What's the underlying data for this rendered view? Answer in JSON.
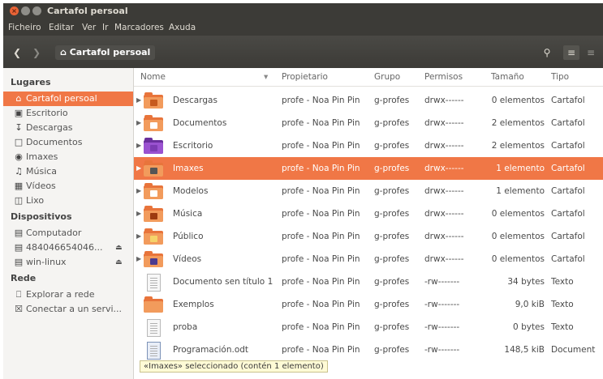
{
  "window": {
    "title": "Cartafol persoal"
  },
  "menubar": [
    "Ficheiro",
    "Editar",
    "Ver",
    "Ir",
    "Marcadores",
    "Axuda"
  ],
  "toolbar": {
    "back_icon": "back-arrow-icon",
    "forward_icon": "forward-arrow-icon",
    "location": "Cartafol persoal",
    "search_icon": "search-icon",
    "list_view_icon": "list-view-icon",
    "grid_view_icon": "grid-view-icon"
  },
  "sidebar": {
    "places_heading": "Lugares",
    "places": [
      {
        "label": "Cartafol persoal",
        "icon": "home-icon",
        "selected": true
      },
      {
        "label": "Escritorio",
        "icon": "desktop-icon"
      },
      {
        "label": "Descargas",
        "icon": "download-icon"
      },
      {
        "label": "Documentos",
        "icon": "documents-icon"
      },
      {
        "label": "Imaxes",
        "icon": "camera-icon"
      },
      {
        "label": "Música",
        "icon": "music-icon"
      },
      {
        "label": "Vídeos",
        "icon": "film-icon"
      },
      {
        "label": "Lixo",
        "icon": "trash-icon"
      }
    ],
    "devices_heading": "Dispositivos",
    "devices": [
      {
        "label": "Computador",
        "icon": "drive-icon"
      },
      {
        "label": "484046654046...",
        "icon": "drive-icon",
        "eject": true
      },
      {
        "label": "win-linux",
        "icon": "drive-icon",
        "eject": true
      }
    ],
    "network_heading": "Rede",
    "network": [
      {
        "label": "Explorar a rede",
        "icon": "network-icon"
      },
      {
        "label": "Conectar a un servi...",
        "icon": "server-icon"
      }
    ]
  },
  "columns": [
    "Nome",
    "Propietario",
    "Grupo",
    "Permisos",
    "Tamaño",
    "Tipo"
  ],
  "files": [
    {
      "name": "Descargas",
      "owner": "profe - Noa Pin Pin",
      "group": "g-profes",
      "perms": "drwx------",
      "size": "0 elementos",
      "type": "Cartafol",
      "kind": "folder",
      "emblem": "#c75a1e"
    },
    {
      "name": "Documentos",
      "owner": "profe - Noa Pin Pin",
      "group": "g-profes",
      "perms": "drwx------",
      "size": "2 elementos",
      "type": "Cartafol",
      "kind": "folder",
      "emblem": "#ffffff"
    },
    {
      "name": "Escritorio",
      "owner": "profe - Noa Pin Pin",
      "group": "g-profes",
      "perms": "drwx------",
      "size": "2 elementos",
      "type": "Cartafol",
      "kind": "desktop",
      "emblem": "#7d3bb3"
    },
    {
      "name": "Imaxes",
      "owner": "profe - Noa Pin Pin",
      "group": "g-profes",
      "perms": "drwx------",
      "size": "1 elemento",
      "type": "Cartafol",
      "kind": "folder",
      "emblem": "#555555",
      "selected": true
    },
    {
      "name": "Modelos",
      "owner": "profe - Noa Pin Pin",
      "group": "g-profes",
      "perms": "drwx------",
      "size": "1 elemento",
      "type": "Cartafol",
      "kind": "folder",
      "emblem": "#ffffff"
    },
    {
      "name": "Música",
      "owner": "profe - Noa Pin Pin",
      "group": "g-profes",
      "perms": "drwx------",
      "size": "0 elementos",
      "type": "Cartafol",
      "kind": "folder",
      "emblem": "#9c3a10"
    },
    {
      "name": "Público",
      "owner": "profe - Noa Pin Pin",
      "group": "g-profes",
      "perms": "drwx------",
      "size": "0 elementos",
      "type": "Cartafol",
      "kind": "folder",
      "emblem": "#f5d36a"
    },
    {
      "name": "Vídeos",
      "owner": "profe - Noa Pin Pin",
      "group": "g-profes",
      "perms": "drwx------",
      "size": "0 elementos",
      "type": "Cartafol",
      "kind": "folder",
      "emblem": "#4b3a8f"
    },
    {
      "name": "Documento sen título 1",
      "owner": "profe - Noa Pin Pin",
      "group": "g-profes",
      "perms": "-rw-------",
      "size": "34 bytes",
      "type": "Texto",
      "kind": "doc"
    },
    {
      "name": "Exemplos",
      "owner": "profe - Noa Pin Pin",
      "group": "g-profes",
      "perms": "-rw-------",
      "size": "9,0 kiB",
      "type": "Texto",
      "kind": "folder-plain"
    },
    {
      "name": "proba",
      "owner": "profe - Noa Pin Pin",
      "group": "g-profes",
      "perms": "-rw-------",
      "size": "0 bytes",
      "type": "Texto",
      "kind": "doc"
    },
    {
      "name": "Programación.odt",
      "owner": "profe - Noa Pin Pin",
      "group": "g-profes",
      "perms": "-rw-------",
      "size": "148,5 kiB",
      "type": "Document",
      "kind": "odt"
    }
  ],
  "status": "«Imaxes» seleccionado  (contén 1 elemento)",
  "colors": {
    "accent": "#f07746",
    "titlebar": "#3c3b37"
  }
}
